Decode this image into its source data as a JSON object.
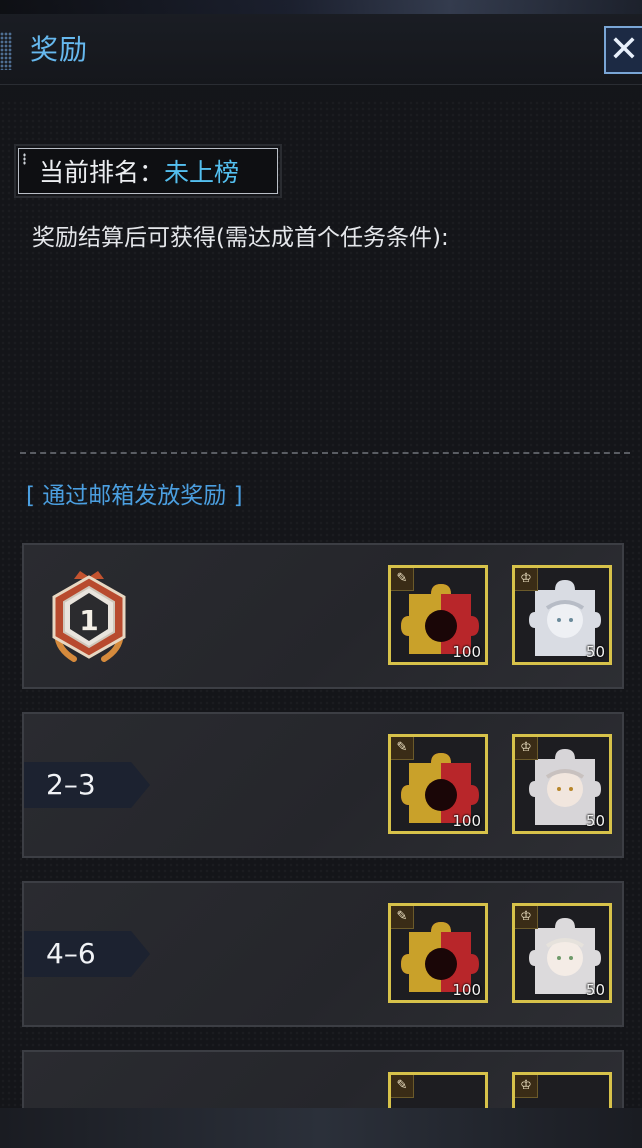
{
  "header": {
    "title": "奖励",
    "close_icon": "✕"
  },
  "rank": {
    "label": "当前排名：",
    "value": "未上榜"
  },
  "info_text": "奖励结算后可获得(需达成首个任务条件):",
  "mail_note": "[ 通过邮箱发放奖励 ]",
  "rows": [
    {
      "rank_label": "1",
      "medal": "rank-1-medal",
      "items": [
        {
          "type": "red-puzzle",
          "qty": "100"
        },
        {
          "type": "character-puzzle",
          "qty": "50"
        }
      ]
    },
    {
      "rank_label": "2–3",
      "items": [
        {
          "type": "red-puzzle",
          "qty": "100"
        },
        {
          "type": "character-puzzle",
          "qty": "50"
        }
      ]
    },
    {
      "rank_label": "4–6",
      "items": [
        {
          "type": "red-puzzle",
          "qty": "100"
        },
        {
          "type": "character-puzzle",
          "qty": "50"
        }
      ]
    },
    {
      "rank_label": "",
      "items": [
        {
          "type": "red-puzzle",
          "qty": ""
        },
        {
          "type": "character-puzzle",
          "qty": ""
        }
      ]
    }
  ],
  "colors": {
    "accent_blue": "#66b8ee",
    "rank_value": "#54c0f0",
    "item_border": "#d7c24a",
    "medal_red": "#b84a2e"
  }
}
